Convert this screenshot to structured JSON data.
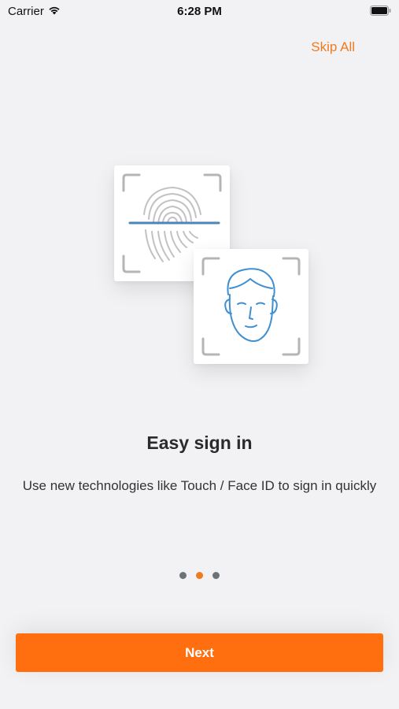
{
  "status_bar": {
    "carrier": "Carrier",
    "time": "6:28 PM",
    "icons": [
      "wifi-icon",
      "battery-icon"
    ]
  },
  "header": {
    "skip_label": "Skip All"
  },
  "illustration": {
    "cards": [
      "fingerprint-icon",
      "face-id-icon"
    ]
  },
  "slide": {
    "title": "Easy sign in",
    "description": "Use new technologies like Touch / Face ID to sign in quickly"
  },
  "pager": {
    "total": 3,
    "active_index": 1
  },
  "footer": {
    "next_label": "Next"
  },
  "colors": {
    "accent": "#ff6f0f",
    "skip_text": "#f07a1e",
    "background": "#f2f2f4",
    "icon_blue": "#3f8fd1",
    "icon_gray": "#b5b5b5"
  }
}
